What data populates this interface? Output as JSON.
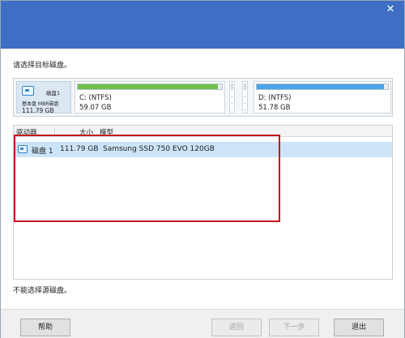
{
  "titlebar": {
    "close_glyph": "✕"
  },
  "prompt": "请选择目标磁盘。",
  "diskbar": {
    "disk_name": "磁盘1",
    "disk_type": "基本盘 MBR磁盘",
    "disk_size": "111.79 GB",
    "partitions": [
      {
        "label": "C: (NTFS)",
        "size": "59.07 GB",
        "used_fraction": 0.97,
        "fill_color": "#6fbf4a"
      },
      {
        "label": "D: (NTFS)",
        "size": "51.78 GB",
        "used_fraction": 0.97,
        "fill_color": "#4aa4e8"
      }
    ],
    "mini_separator": "-"
  },
  "table": {
    "columns": [
      "驱动器",
      "大小",
      "模型"
    ],
    "rows": [
      {
        "drive": "磁盘 1",
        "size": "111.79 GB",
        "model": "Samsung SSD 750 EVO 120GB"
      }
    ]
  },
  "warning": "不能选择源磁盘。",
  "footer": {
    "help": "帮助",
    "back": "返回",
    "next": "下一步",
    "exit": "退出"
  },
  "colors": {
    "titlebar": "#3e6fc4",
    "selection": "#cce4f7",
    "highlight": "#c4161c"
  }
}
